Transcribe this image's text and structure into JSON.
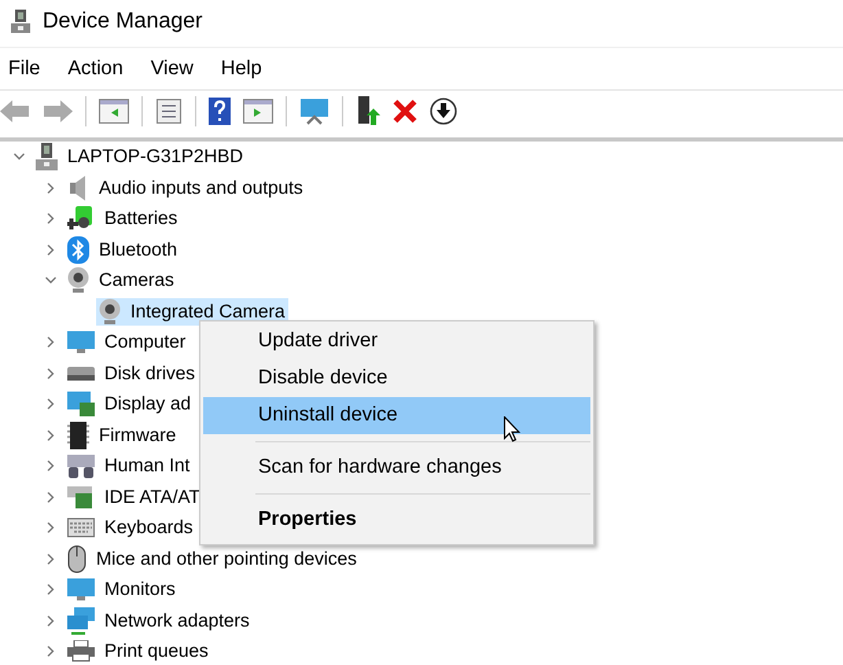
{
  "window": {
    "title": "Device Manager"
  },
  "menu_bar": [
    "File",
    "Action",
    "View",
    "Help"
  ],
  "tree": [
    {
      "label": "LAPTOP-G31P2HBD",
      "kind": "computer",
      "expanded": true,
      "selected": false,
      "children": [
        {
          "label": "Audio inputs and outputs",
          "kind": "audio",
          "expanded": false,
          "selected": false
        },
        {
          "label": "Batteries",
          "kind": "battery",
          "expanded": false,
          "selected": false
        },
        {
          "label": "Bluetooth",
          "kind": "bluetooth",
          "expanded": false,
          "selected": false
        },
        {
          "label": "Cameras",
          "kind": "camera",
          "expanded": true,
          "selected": false,
          "children": [
            {
              "label": "Integrated Camera",
              "kind": "camera",
              "selected": true
            }
          ]
        },
        {
          "label": "Computer",
          "kind": "monitor",
          "expanded": false,
          "selected": false
        },
        {
          "label": "Disk drives",
          "kind": "disk",
          "expanded": false,
          "selected": false
        },
        {
          "label": "Display ad",
          "kind": "display",
          "expanded": false,
          "selected": false
        },
        {
          "label": "Firmware",
          "kind": "chip",
          "expanded": false,
          "selected": false
        },
        {
          "label": "Human Int",
          "kind": "hid",
          "expanded": false,
          "selected": false
        },
        {
          "label": "IDE ATA/AT",
          "kind": "ide",
          "expanded": false,
          "selected": false
        },
        {
          "label": "Keyboards",
          "kind": "keyboard",
          "expanded": false,
          "selected": false
        },
        {
          "label": "Mice and other pointing devices",
          "kind": "mouse",
          "expanded": false,
          "selected": false
        },
        {
          "label": "Monitors",
          "kind": "monitor",
          "expanded": false,
          "selected": false
        },
        {
          "label": "Network adapters",
          "kind": "network",
          "expanded": false,
          "selected": false
        },
        {
          "label": "Print queues",
          "kind": "printer",
          "expanded": false,
          "selected": false
        }
      ]
    }
  ],
  "context_menu": [
    {
      "kind": "item",
      "label": "Update driver",
      "selected": false,
      "default": false
    },
    {
      "kind": "item",
      "label": "Disable device",
      "selected": false,
      "default": false
    },
    {
      "kind": "item",
      "label": "Uninstall device",
      "selected": true,
      "default": false
    },
    {
      "kind": "separator"
    },
    {
      "kind": "item",
      "label": "Scan for hardware changes",
      "selected": false,
      "default": false
    },
    {
      "kind": "separator"
    },
    {
      "kind": "item",
      "label": "Properties",
      "selected": false,
      "default": true
    }
  ]
}
